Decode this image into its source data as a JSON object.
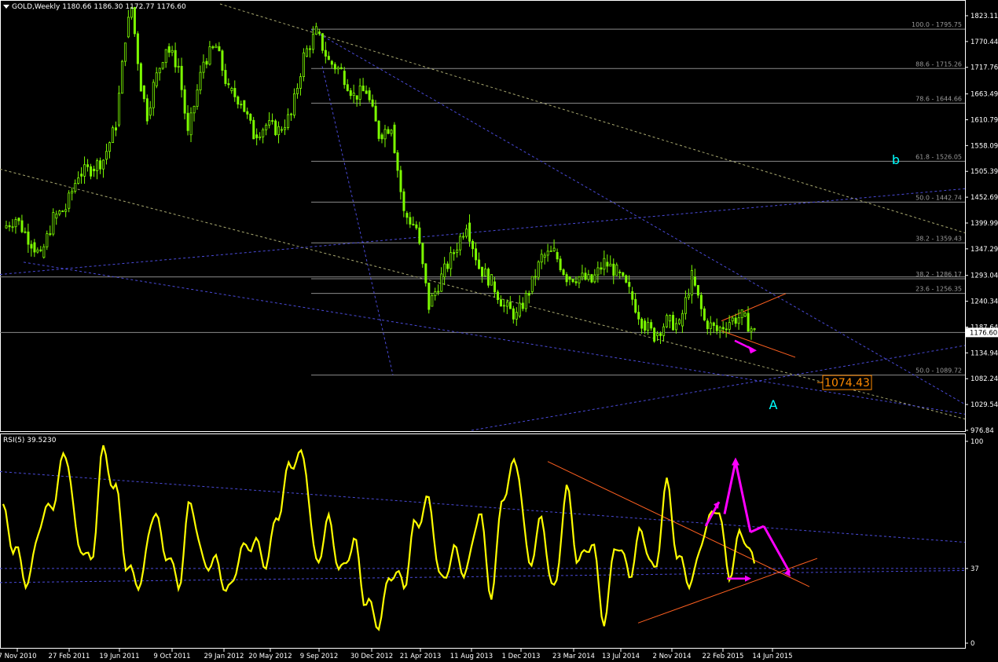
{
  "header": {
    "symbol": "GOLD,Weekly",
    "ohlc": "1180.66 1186.30 1172.77 1176.60",
    "rsi_label": "RSI(5) 39.5230"
  },
  "colors": {
    "background": "#000000",
    "candles": "#7CFC00",
    "rsi": "#FFFF00",
    "fib_lines": "#8a8a8a",
    "trend_blue": "#4a4ad8",
    "trend_khaki": "#a8a870",
    "orange_lines": "#ff6020",
    "magenta_arrows": "#ff00ff",
    "wave_labels": "#00ffff",
    "price_box": "#ff8a00",
    "axis_text": "#ffffff"
  },
  "chart_data": [
    {
      "type": "candlestick",
      "symbol": "GOLD",
      "timeframe": "Weekly",
      "last_price": 1176.6,
      "ylim": [
        976.84,
        1823.11
      ],
      "price_ticks": [
        1823.11,
        1770.44,
        1717.76,
        1663.49,
        1610.79,
        1558.09,
        1505.39,
        1452.69,
        1399.99,
        1347.29,
        1293.04,
        1240.34,
        1187.64,
        1134.94,
        1082.24,
        1029.54,
        976.84
      ],
      "date_ticks": [
        "7 Nov 2010",
        "27 Feb 2011",
        "19 Jun 2011",
        "9 Oct 2011",
        "29 Jan 2012",
        "20 May 2012",
        "9 Sep 2012",
        "30 Dec 2012",
        "21 Apr 2013",
        "11 Aug 2013",
        "1 Dec 2013",
        "23 Mar 2014",
        "13 Jul 2014",
        "2 Nov 2014",
        "22 Feb 2015",
        "14 Jun 2015"
      ],
      "fibonacci_levels": [
        {
          "label": "100.0 - 1795.75",
          "price": 1795.75
        },
        {
          "label": "88.6 - 1715.26",
          "price": 1715.26
        },
        {
          "label": "78.6 - 1644.66",
          "price": 1644.66
        },
        {
          "label": "61.8 - 1526.05",
          "price": 1526.05
        },
        {
          "label": "50.0 - 1442.74",
          "price": 1442.74
        },
        {
          "label": "38.2 - 1359.43",
          "price": 1359.43
        },
        {
          "label": "38.2 - 1286.17",
          "price": 1286.17
        },
        {
          "label": "23.6 - 1256.35",
          "price": 1256.35
        },
        {
          "label": "50.0 - 1089.72",
          "price": 1089.72
        }
      ],
      "price_label": "1074.43",
      "wave_labels": [
        "b",
        "A"
      ],
      "series_close": [
        {
          "date": "2010-11-07",
          "close": 1390
        },
        {
          "date": "2010-12-05",
          "close": 1410
        },
        {
          "date": "2011-01-09",
          "close": 1360
        },
        {
          "date": "2011-01-30",
          "close": 1330
        },
        {
          "date": "2011-02-27",
          "close": 1410
        },
        {
          "date": "2011-03-27",
          "close": 1430
        },
        {
          "date": "2011-04-24",
          "close": 1500
        },
        {
          "date": "2011-05-22",
          "close": 1510
        },
        {
          "date": "2011-06-19",
          "close": 1530
        },
        {
          "date": "2011-07-17",
          "close": 1600
        },
        {
          "date": "2011-08-07",
          "close": 1780
        },
        {
          "date": "2011-08-21",
          "close": 1840
        },
        {
          "date": "2011-09-11",
          "close": 1680
        },
        {
          "date": "2011-09-25",
          "close": 1620
        },
        {
          "date": "2011-10-09",
          "close": 1680
        },
        {
          "date": "2011-11-06",
          "close": 1760
        },
        {
          "date": "2011-12-04",
          "close": 1720
        },
        {
          "date": "2011-12-25",
          "close": 1580
        },
        {
          "date": "2012-01-29",
          "close": 1730
        },
        {
          "date": "2012-02-26",
          "close": 1760
        },
        {
          "date": "2012-03-25",
          "close": 1670
        },
        {
          "date": "2012-04-22",
          "close": 1650
        },
        {
          "date": "2012-05-20",
          "close": 1580
        },
        {
          "date": "2012-06-17",
          "close": 1600
        },
        {
          "date": "2012-07-15",
          "close": 1590
        },
        {
          "date": "2012-08-12",
          "close": 1620
        },
        {
          "date": "2012-09-09",
          "close": 1740
        },
        {
          "date": "2012-10-07",
          "close": 1790
        },
        {
          "date": "2012-11-04",
          "close": 1730
        },
        {
          "date": "2012-12-02",
          "close": 1710
        },
        {
          "date": "2012-12-30",
          "close": 1660
        },
        {
          "date": "2013-01-27",
          "close": 1670
        },
        {
          "date": "2013-02-24",
          "close": 1580
        },
        {
          "date": "2013-03-24",
          "close": 1600
        },
        {
          "date": "2013-04-21",
          "close": 1420
        },
        {
          "date": "2013-05-19",
          "close": 1390
        },
        {
          "date": "2013-06-16",
          "close": 1230
        },
        {
          "date": "2013-07-14",
          "close": 1290
        },
        {
          "date": "2013-08-11",
          "close": 1340
        },
        {
          "date": "2013-09-08",
          "close": 1400
        },
        {
          "date": "2013-10-06",
          "close": 1310
        },
        {
          "date": "2013-11-03",
          "close": 1280
        },
        {
          "date": "2013-12-01",
          "close": 1230
        },
        {
          "date": "2013-12-29",
          "close": 1210
        },
        {
          "date": "2014-01-26",
          "close": 1260
        },
        {
          "date": "2014-02-23",
          "close": 1330
        },
        {
          "date": "2014-03-23",
          "close": 1340
        },
        {
          "date": "2014-04-20",
          "close": 1290
        },
        {
          "date": "2014-05-18",
          "close": 1290
        },
        {
          "date": "2014-06-15",
          "close": 1280
        },
        {
          "date": "2014-07-13",
          "close": 1320
        },
        {
          "date": "2014-08-10",
          "close": 1300
        },
        {
          "date": "2014-09-07",
          "close": 1260
        },
        {
          "date": "2014-10-05",
          "close": 1200
        },
        {
          "date": "2014-11-02",
          "close": 1170
        },
        {
          "date": "2014-11-30",
          "close": 1200
        },
        {
          "date": "2014-12-28",
          "close": 1190
        },
        {
          "date": "2015-01-25",
          "close": 1290
        },
        {
          "date": "2015-02-22",
          "close": 1200
        },
        {
          "date": "2015-03-22",
          "close": 1180
        },
        {
          "date": "2015-04-19",
          "close": 1200
        },
        {
          "date": "2015-05-17",
          "close": 1210
        },
        {
          "date": "2015-06-14",
          "close": 1176.6
        }
      ]
    },
    {
      "type": "line",
      "name": "RSI(5)",
      "last_value": 39.523,
      "ylim": [
        0,
        100
      ],
      "ticks": [
        100,
        37,
        0
      ],
      "series": [
        {
          "date": "2010-11-07",
          "value": 65
        },
        {
          "date": "2010-12-05",
          "value": 45
        },
        {
          "date": "2011-01-02",
          "value": 30
        },
        {
          "date": "2011-01-30",
          "value": 60
        },
        {
          "date": "2011-02-27",
          "value": 70
        },
        {
          "date": "2011-03-27",
          "value": 95
        },
        {
          "date": "2011-04-24",
          "value": 50
        },
        {
          "date": "2011-05-22",
          "value": 40
        },
        {
          "date": "2011-06-19",
          "value": 95
        },
        {
          "date": "2011-07-17",
          "value": 75
        },
        {
          "date": "2011-08-14",
          "value": 35
        },
        {
          "date": "2011-09-11",
          "value": 30
        },
        {
          "date": "2011-10-09",
          "value": 65
        },
        {
          "date": "2011-11-06",
          "value": 45
        },
        {
          "date": "2011-12-04",
          "value": 30
        },
        {
          "date": "2012-01-01",
          "value": 70
        },
        {
          "date": "2012-01-29",
          "value": 40
        },
        {
          "date": "2012-02-26",
          "value": 40
        },
        {
          "date": "2012-03-25",
          "value": 25
        },
        {
          "date": "2012-04-22",
          "value": 45
        },
        {
          "date": "2012-05-20",
          "value": 50
        },
        {
          "date": "2012-06-17",
          "value": 40
        },
        {
          "date": "2012-07-15",
          "value": 65
        },
        {
          "date": "2012-08-12",
          "value": 90
        },
        {
          "date": "2012-09-09",
          "value": 92
        },
        {
          "date": "2012-10-07",
          "value": 40
        },
        {
          "date": "2012-11-04",
          "value": 60
        },
        {
          "date": "2012-12-02",
          "value": 35
        },
        {
          "date": "2012-12-30",
          "value": 50
        },
        {
          "date": "2013-01-27",
          "value": 20
        },
        {
          "date": "2013-02-24",
          "value": 10
        },
        {
          "date": "2013-03-24",
          "value": 35
        },
        {
          "date": "2013-04-21",
          "value": 30
        },
        {
          "date": "2013-05-19",
          "value": 60
        },
        {
          "date": "2013-06-16",
          "value": 70
        },
        {
          "date": "2013-07-14",
          "value": 30
        },
        {
          "date": "2013-08-11",
          "value": 45
        },
        {
          "date": "2013-09-08",
          "value": 35
        },
        {
          "date": "2013-10-06",
          "value": 65
        },
        {
          "date": "2013-11-03",
          "value": 25
        },
        {
          "date": "2013-12-01",
          "value": 75
        },
        {
          "date": "2013-12-29",
          "value": 90
        },
        {
          "date": "2014-01-26",
          "value": 40
        },
        {
          "date": "2014-02-23",
          "value": 60
        },
        {
          "date": "2014-03-23",
          "value": 25
        },
        {
          "date": "2014-04-20",
          "value": 75
        },
        {
          "date": "2014-05-18",
          "value": 40
        },
        {
          "date": "2014-06-15",
          "value": 50
        },
        {
          "date": "2014-07-13",
          "value": 12
        },
        {
          "date": "2014-08-10",
          "value": 50
        },
        {
          "date": "2014-09-07",
          "value": 35
        },
        {
          "date": "2014-10-05",
          "value": 55
        },
        {
          "date": "2014-11-02",
          "value": 35
        },
        {
          "date": "2014-11-30",
          "value": 78
        },
        {
          "date": "2014-12-28",
          "value": 40
        },
        {
          "date": "2015-01-25",
          "value": 30
        },
        {
          "date": "2015-02-22",
          "value": 55
        },
        {
          "date": "2015-03-22",
          "value": 68
        },
        {
          "date": "2015-04-19",
          "value": 35
        },
        {
          "date": "2015-05-17",
          "value": 55
        },
        {
          "date": "2015-06-14",
          "value": 39.5
        }
      ]
    }
  ]
}
